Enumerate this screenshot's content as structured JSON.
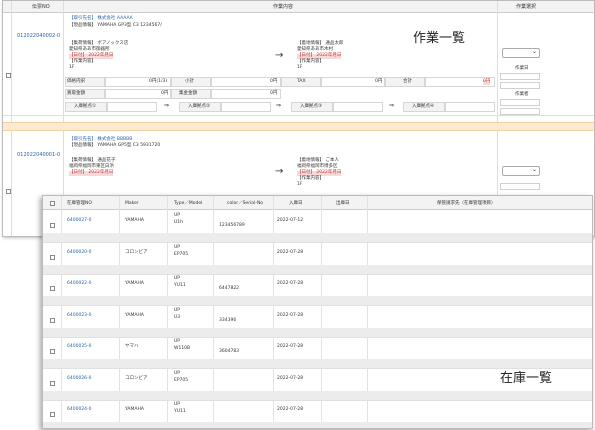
{
  "work_list": {
    "title": "作業一覧",
    "header": {
      "col_no": "伝票NO",
      "col_content": "作業内容",
      "col_select": "作業選択"
    },
    "records": [
      {
        "slip_no": "012022040002-0",
        "customer": "【取引先名】 株式会社 AAAAA",
        "model": "【現品情報】 YAMAHA GP3型 C3 1234567/",
        "pickup_label": "【集荷情報】 ボアノックス店",
        "pickup_addr": "愛知県ああ市御器所",
        "pickup_date": "【日付】 2022年月日",
        "pickup_work": "【作業内容】",
        "pickup_floor": "1F",
        "arrow": "→",
        "delivery_label": "【着地情報】 通品太郎",
        "delivery_addr": "愛知県ああ市木村",
        "delivery_date": "【日付】 2022年月日",
        "delivery_work": "【作業内容】",
        "delivery_floor": "1F",
        "fees": {
          "price_label": "価格内訳",
          "price_value": "0円(1/3)",
          "subtotal_label": "小計",
          "subtotal_value": "0円",
          "tax_label": "TAX",
          "tax_value": "0円",
          "total_label": "合計",
          "total_value": "0円",
          "sales_label": "買取金額",
          "sales_value": "0円",
          "collect_label": "集金金額",
          "collect_value": "0円"
        },
        "checkpoints": [
          "入庫拠点①",
          "入庫拠点②",
          "入庫拠点③",
          "入庫拠点④"
        ],
        "side_labels": [
          "作業日",
          "作業者"
        ]
      },
      {
        "slip_no": "012022040001-0",
        "customer": "【取引先名】 株式会社 BBBBB",
        "model": "【現品情報】 YAMAHA GP5型 C3 5931720",
        "pickup_label": "【集荷情報】 通品花子",
        "pickup_addr": "福岡県福岡市東区白浜",
        "pickup_date": "【日付】 2022年月日",
        "arrow": "→",
        "delivery_label": "【着地情報】 ご本人",
        "delivery_addr": "福岡県福岡市博多区",
        "delivery_date": "【日付】 2022年月日",
        "delivery_work": "【作業内容】",
        "delivery_floor": "1F"
      }
    ]
  },
  "stock_list": {
    "title": "在庫一覧",
    "headers": [
      "在庫管理NO",
      "Maker",
      "Type／Model",
      "color／Serial-No",
      "入庫日",
      "出庫日",
      "保管請求先（在庫管理項目）"
    ],
    "rows": [
      {
        "no": "6400027-0",
        "maker": "YAMAHA",
        "type1": "UP",
        "type2": "U1h",
        "serial": "123456789",
        "in_date": "2022-07-12"
      },
      {
        "no": "6400020-0",
        "maker": "コロンビア",
        "type1": "UP",
        "type2": "EP705",
        "serial": "",
        "in_date": "2022-07-28"
      },
      {
        "no": "6400022-0",
        "maker": "YAMAHA",
        "type1": "UP",
        "type2": "YU11",
        "serial": "6447822",
        "in_date": "2022-07-28"
      },
      {
        "no": "6400023-0",
        "maker": "YAMAHA",
        "type1": "UP",
        "type2": "U3",
        "serial": "334396",
        "in_date": "2022-07-28"
      },
      {
        "no": "6400025-0",
        "maker": "ヤマハ",
        "type1": "UP",
        "type2": "W110B",
        "serial": "3604783",
        "in_date": "2022-07-28"
      },
      {
        "no": "6400026-0",
        "maker": "コロンビア",
        "type1": "UP",
        "type2": "EP705",
        "serial": "",
        "in_date": "2022-07-28"
      },
      {
        "no": "6400024-0",
        "maker": "YAMAHA",
        "type1": "UP",
        "type2": "YU11",
        "serial": "",
        "in_date": "2022-07-28"
      }
    ]
  },
  "colors": {
    "link": "#2b63a8",
    "highlight": "#f6d9dd",
    "divider_band": "#fbe9d0"
  }
}
